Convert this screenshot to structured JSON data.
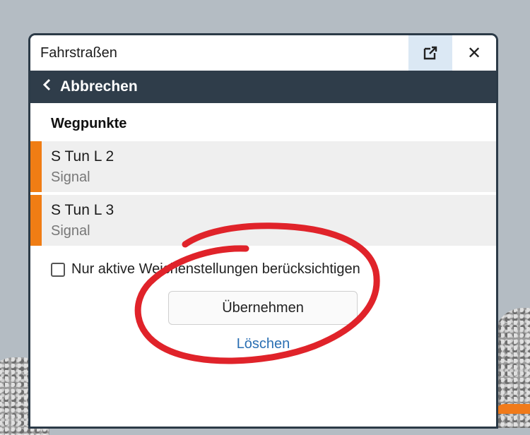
{
  "window": {
    "title": "Fahrstraßen"
  },
  "titlebar": {
    "popout_icon": "popout-icon",
    "close_icon": "close-icon",
    "close_glyph": "✕"
  },
  "nav": {
    "back_label": "Abbrechen",
    "back_glyph": "‹"
  },
  "section": {
    "title": "Wegpunkte"
  },
  "waypoints": [
    {
      "name": "S Tun L 2",
      "type": "Signal"
    },
    {
      "name": "S Tun L 3",
      "type": "Signal"
    }
  ],
  "options": {
    "active_switches_label": "Nur aktive Weichenstellungen berücksichtigen",
    "active_switches_checked": false
  },
  "actions": {
    "apply_label": "Übernehmen",
    "delete_label": "Löschen"
  },
  "colors": {
    "accent": "#f07d14",
    "nav_bg": "#2f3d4a",
    "link": "#2a6fb3",
    "annotation": "#e0232a"
  }
}
